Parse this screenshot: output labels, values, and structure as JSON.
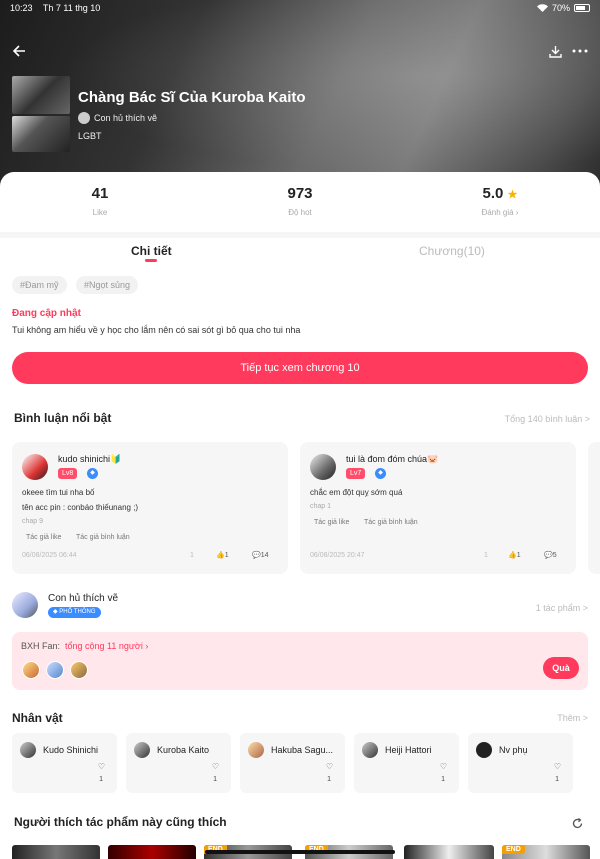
{
  "status_bar": {
    "time": "10:23",
    "date": "Th 7 11 thg 10",
    "battery": "70%",
    "wifi_icon": "wifi-icon"
  },
  "header": {
    "back_icon": "arrow-left-icon",
    "download_icon": "download-icon",
    "more_icon": "more-icon",
    "title": "Chàng Bác Sĩ Của Kuroba Kaito",
    "author": "Con hủ thích vẽ",
    "genre": "LGBT"
  },
  "stats": [
    {
      "value": "41",
      "label": "Like"
    },
    {
      "value": "973",
      "label": "Độ hot"
    },
    {
      "value": "5.0",
      "label": "Đánh giá"
    }
  ],
  "tabs": [
    {
      "label": "Chi tiết"
    },
    {
      "label": "Chương(10)"
    }
  ],
  "tags": [
    "#Đam mỹ",
    "#Ngọt sủng"
  ],
  "update_status": "Đang cập nhật",
  "description": "Tui không am hiểu về y học cho lắm nên có sai sót gì bỏ qua cho tui nha",
  "continue_button": "Tiếp tục xem chương 10",
  "comments_section": {
    "title": "Bình luận nổi bật",
    "total": "Tổng 140 bình luận >",
    "items": [
      {
        "name": "kudo shinichi🔰",
        "level": "Lv8",
        "line1": "okeee tìm tui nha bố",
        "line2": "tên acc pin : conbáo thiếunang ;)",
        "chapter": "chap 9",
        "chip1": "Tác giả like",
        "chip2": "Tác giả bình luận",
        "date": "06/08/2025 06:44",
        "n0": "1",
        "likes": "1",
        "replies": "14"
      },
      {
        "name": "tui là đom đóm chúa🐷",
        "level": "Lv7",
        "line1": "chắc em đột quỵ sớm quá",
        "line2": "",
        "chapter": "chap 1",
        "chip1": "Tác giả like",
        "chip2": "Tác giả bình luận",
        "date": "06/08/2025 20:47",
        "n0": "1",
        "likes": "1",
        "replies": "5"
      }
    ]
  },
  "author_row": {
    "name": "Con hủ thích vẽ",
    "badge": "PHỔ THÔNG",
    "works": "1 tác phẩm >"
  },
  "fan_rank": {
    "label": "BXH Fan:",
    "total": "tổng cộng 11 người ›",
    "button": "Quà"
  },
  "characters_section": {
    "title": "Nhân vật",
    "more": "Thêm >",
    "items": [
      {
        "name": "Kudo Shinichi",
        "likes": "1"
      },
      {
        "name": "Kuroba Kaito",
        "likes": "1"
      },
      {
        "name": "Hakuba Sagu...",
        "likes": "1"
      },
      {
        "name": "Heiji Hattori",
        "likes": "1"
      },
      {
        "name": "Nv phụ",
        "likes": "1"
      }
    ]
  },
  "recommend_section": {
    "title": "Người thích tác phẩm này cũng thích",
    "refresh_icon": "refresh-icon",
    "badges": [
      "END",
      "END",
      "END"
    ]
  },
  "colors": {
    "accent": "#ff3a5c",
    "rating_star": "#f5b400",
    "badge_blue": "#3a8cff"
  }
}
